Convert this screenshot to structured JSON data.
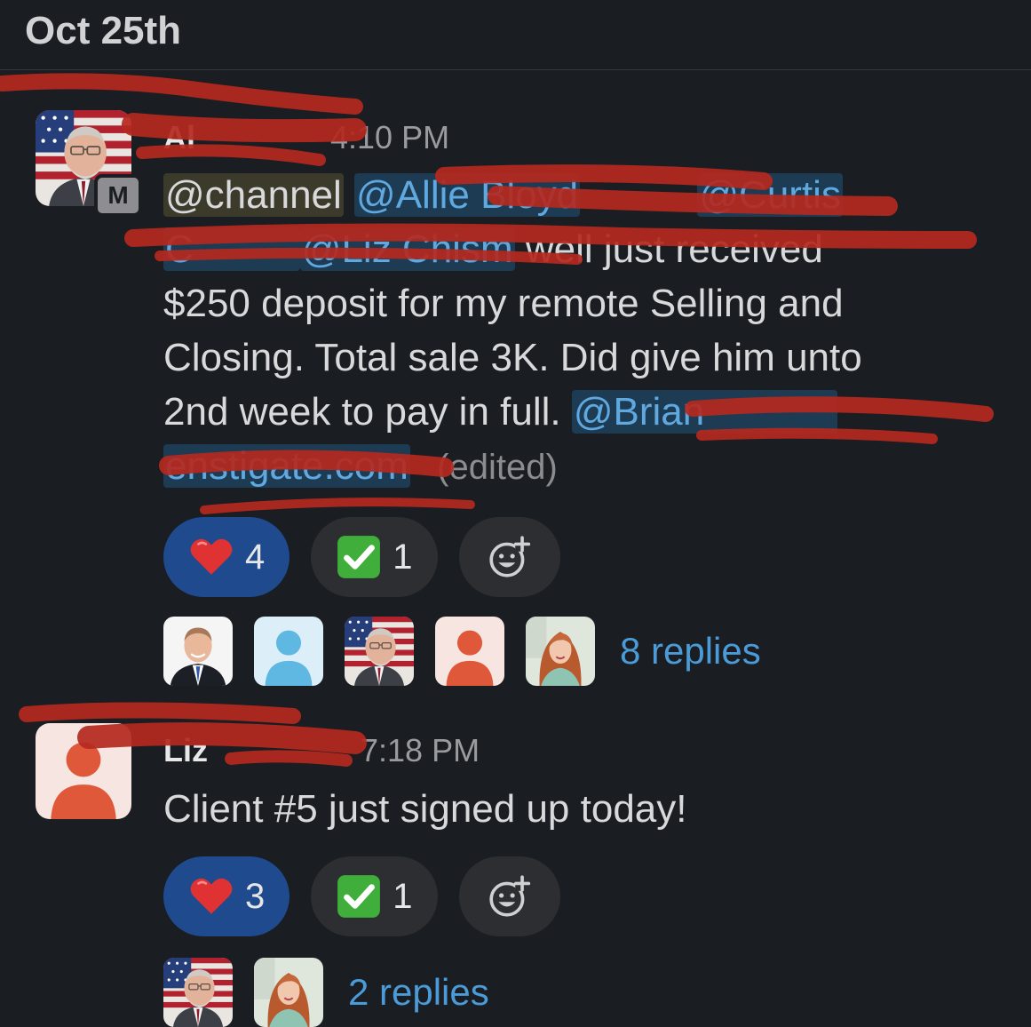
{
  "date_header": "Oct 25th",
  "messages": [
    {
      "author": "Al",
      "author_badge": "M",
      "time": "4:10 PM",
      "mention_channel": "@channel",
      "mention_1": "@Allie Bloyd",
      "mention_2": "@Curtis",
      "mention_3": "C",
      "mention_4": "@Liz Chism",
      "text_line_1": "well just received",
      "text_line_2": "$250 deposit for my remote Selling and",
      "text_line_3": "Closing. Total sale 3K. Did give him unto",
      "text_line_4": "2nd week to pay in full.",
      "mention_5": "@Brian",
      "mention_6": "enstigate.com",
      "edited": "(edited)",
      "reactions": [
        {
          "emoji": "heart-icon",
          "count": "4",
          "active": true
        },
        {
          "emoji": "check-mark-icon",
          "count": "1",
          "active": false
        }
      ],
      "reply_count_label": "8 replies"
    },
    {
      "author": "Liz",
      "time": "7:18 PM",
      "text": "Client #5 just signed up today!",
      "reactions": [
        {
          "emoji": "heart-icon",
          "count": "3",
          "active": true
        },
        {
          "emoji": "check-mark-icon",
          "count": "1",
          "active": false
        }
      ],
      "reply_count_label": "2 replies"
    }
  ],
  "colors": {
    "background": "#1a1d21",
    "mention_bg": "#1d3b53",
    "mention_text": "#5fa9e0",
    "reaction_active": "#1f4a8d",
    "reaction_inactive": "#2c2e32",
    "link": "#4a9bd7",
    "redaction": "#b5291f"
  }
}
